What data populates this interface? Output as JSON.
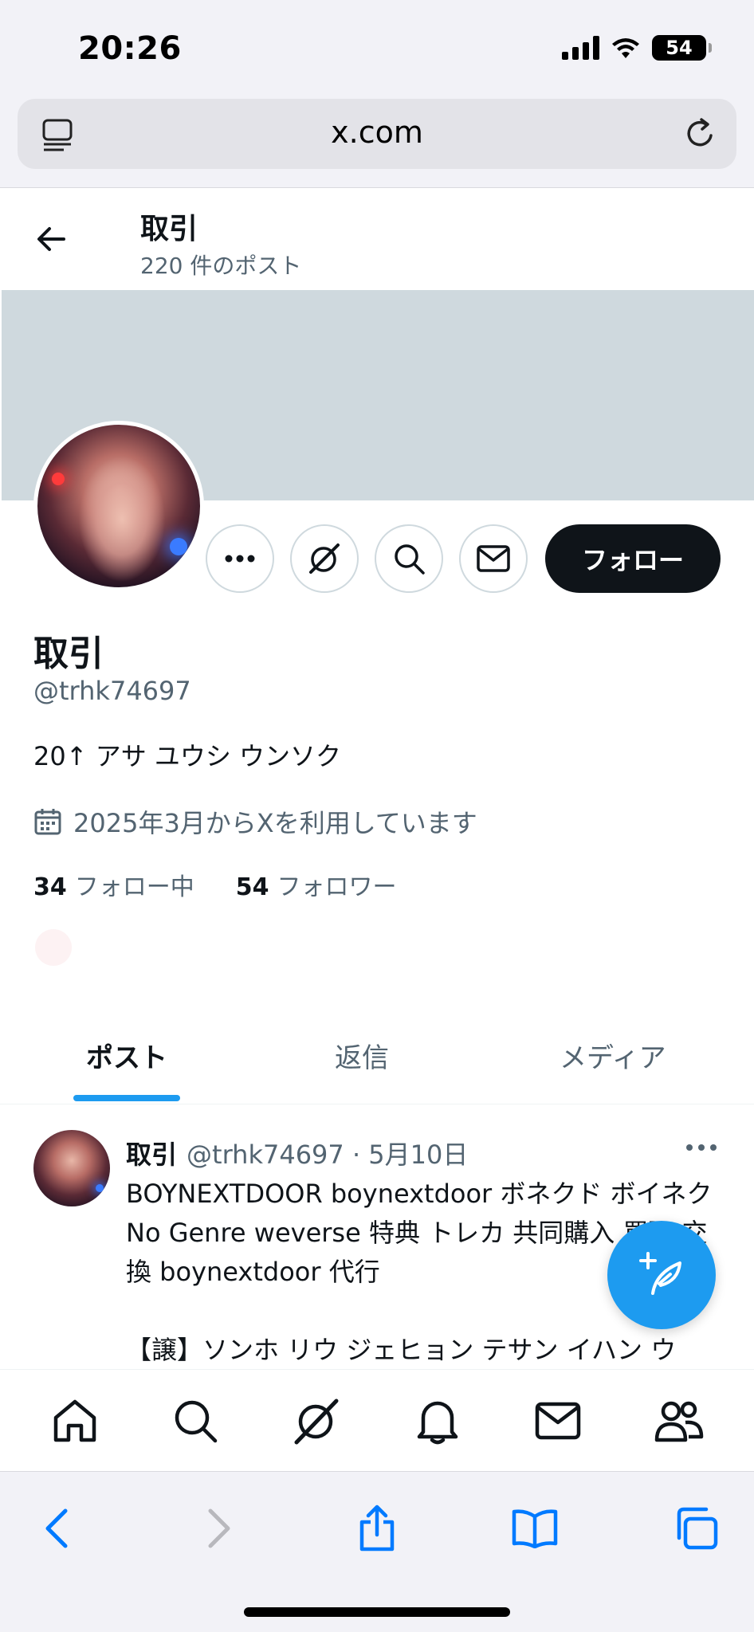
{
  "status_bar": {
    "time": "20:26",
    "battery": "54"
  },
  "browser": {
    "url": "x.com"
  },
  "profile_header": {
    "name": "取引",
    "post_count": "220 件のポスト"
  },
  "profile": {
    "display_name": "取引",
    "handle": "@trhk74697",
    "bio": "20↑ アサ ユウシ ウンソク",
    "joined": "2025年3月からXを利用しています",
    "following_count": "34",
    "following_label": "フォロー中",
    "followers_count": "54",
    "followers_label": "フォロワー",
    "follow_button": "フォロー"
  },
  "tabs": [
    {
      "label": "ポスト",
      "active": true
    },
    {
      "label": "返信",
      "active": false
    },
    {
      "label": "メディア",
      "active": false
    }
  ],
  "post": {
    "name": "取引",
    "meta": "@trhk74697 · 5月10日",
    "text": "BOYNEXTDOOR boynextdoor ボネクド ボイネクNo Genre weverse 特典 トレカ 共同購入 買取 交換 boynextdoor 代行\n\n【譲】ソンホ リウ ジェヒョン テサン イハン ウ"
  },
  "colors": {
    "accent": "#1d9bf0",
    "banner": "#cfd9de",
    "text_secondary": "#536471",
    "ios_blue": "#007aff"
  },
  "icons": [
    "tabs-icon",
    "reload-icon",
    "back-arrow-icon",
    "more-icon",
    "grok-icon",
    "search-icon",
    "mail-icon",
    "calendar-icon",
    "compose-icon",
    "home-icon",
    "bell-icon",
    "people-icon",
    "share-icon",
    "bookmarks-icon",
    "safari-tabs-icon"
  ]
}
